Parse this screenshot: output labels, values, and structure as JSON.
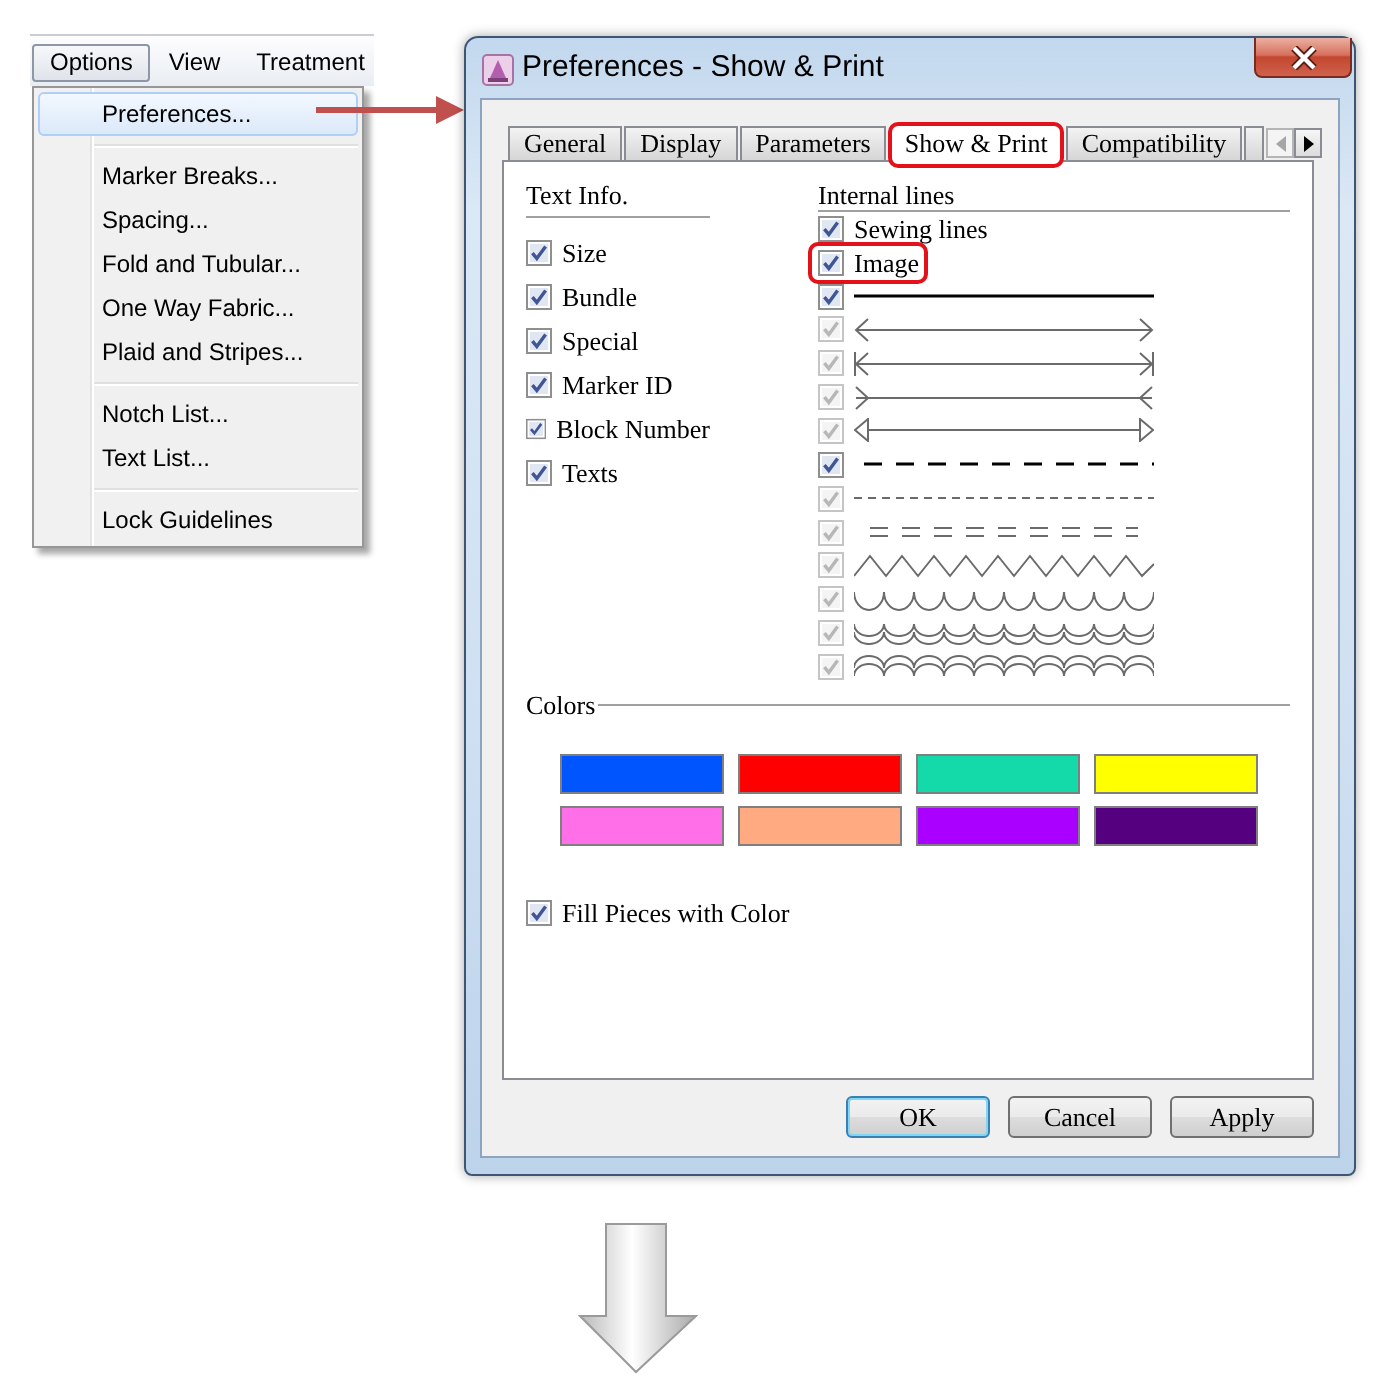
{
  "menu_bar": {
    "items": [
      {
        "label": "Options",
        "selected": true
      },
      {
        "label": "View",
        "selected": false
      },
      {
        "label": "Treatment",
        "selected": false
      }
    ]
  },
  "menu": {
    "sections": [
      {
        "items": [
          {
            "label": "Preferences...",
            "selected": true
          }
        ]
      },
      {
        "items": [
          {
            "label": "Marker Breaks...",
            "selected": false
          },
          {
            "label": "Spacing...",
            "selected": false
          },
          {
            "label": "Fold and Tubular...",
            "selected": false
          },
          {
            "label": "One Way Fabric...",
            "selected": false
          },
          {
            "label": "Plaid and Stripes...",
            "selected": false
          }
        ]
      },
      {
        "items": [
          {
            "label": "Notch List...",
            "selected": false
          },
          {
            "label": "Text List...",
            "selected": false
          }
        ]
      },
      {
        "items": [
          {
            "label": "Lock Guidelines",
            "selected": false
          }
        ]
      }
    ]
  },
  "dialog": {
    "title": "Preferences - Show & Print",
    "tabs": [
      {
        "label": "General",
        "selected": false,
        "highlighted": false
      },
      {
        "label": "Display",
        "selected": false,
        "highlighted": false
      },
      {
        "label": "Parameters",
        "selected": false,
        "highlighted": false
      },
      {
        "label": "Show & Print",
        "selected": true,
        "highlighted": true
      },
      {
        "label": "Compatibility",
        "selected": false,
        "highlighted": false
      }
    ],
    "tab_scroll": [
      {
        "kind": "left",
        "disabled": true
      },
      {
        "kind": "right",
        "disabled": false
      }
    ],
    "text_info": {
      "title": "Text Info.",
      "items": [
        {
          "label": "Size",
          "checked": true
        },
        {
          "label": "Bundle",
          "checked": true
        },
        {
          "label": "Special",
          "checked": true
        },
        {
          "label": "Marker ID",
          "checked": true
        },
        {
          "label": "Block Number",
          "checked": true
        },
        {
          "label": "Texts",
          "checked": true
        }
      ]
    },
    "internal_lines": {
      "title": "Internal lines",
      "items": [
        {
          "kind": "text",
          "label": "Sewing lines",
          "checked": true,
          "disabled": false,
          "highlighted": false
        },
        {
          "kind": "text",
          "label": "Image",
          "checked": true,
          "disabled": false,
          "highlighted": true
        },
        {
          "kind": "solid",
          "checked": true,
          "disabled": false,
          "highlighted": false
        },
        {
          "kind": "open_arrows",
          "checked": true,
          "disabled": true,
          "highlighted": false
        },
        {
          "kind": "bar_arrows",
          "checked": true,
          "disabled": true,
          "highlighted": false
        },
        {
          "kind": "inward_arrows",
          "checked": true,
          "disabled": true,
          "highlighted": false
        },
        {
          "kind": "hollow_arrows",
          "checked": true,
          "disabled": true,
          "highlighted": false
        },
        {
          "kind": "dashed",
          "checked": true,
          "disabled": false,
          "highlighted": false
        },
        {
          "kind": "dash_dot",
          "checked": true,
          "disabled": true,
          "highlighted": false
        },
        {
          "kind": "double_dash",
          "checked": true,
          "disabled": true,
          "highlighted": false
        },
        {
          "kind": "zigzag",
          "checked": true,
          "disabled": true,
          "highlighted": false
        },
        {
          "kind": "wave",
          "checked": true,
          "disabled": true,
          "highlighted": false
        },
        {
          "kind": "double_wave",
          "checked": true,
          "disabled": true,
          "highlighted": false
        },
        {
          "kind": "arcs",
          "checked": true,
          "disabled": true,
          "highlighted": false
        }
      ]
    },
    "colors": {
      "title": "Colors",
      "swatches": [
        {
          "color": "#0055ff"
        },
        {
          "color": "#ff0000"
        },
        {
          "color": "#14d9a8"
        },
        {
          "color": "#ffff00"
        },
        {
          "color": "#ff6fe8"
        },
        {
          "color": "#ffaa80"
        },
        {
          "color": "#aa00ff"
        },
        {
          "color": "#55007f"
        }
      ]
    },
    "fill_pieces": {
      "label": "Fill Pieces with Color",
      "checked": true
    },
    "buttons": [
      {
        "label": "OK",
        "default": true
      },
      {
        "label": "Cancel",
        "default": false
      },
      {
        "label": "Apply",
        "default": false
      }
    ]
  }
}
